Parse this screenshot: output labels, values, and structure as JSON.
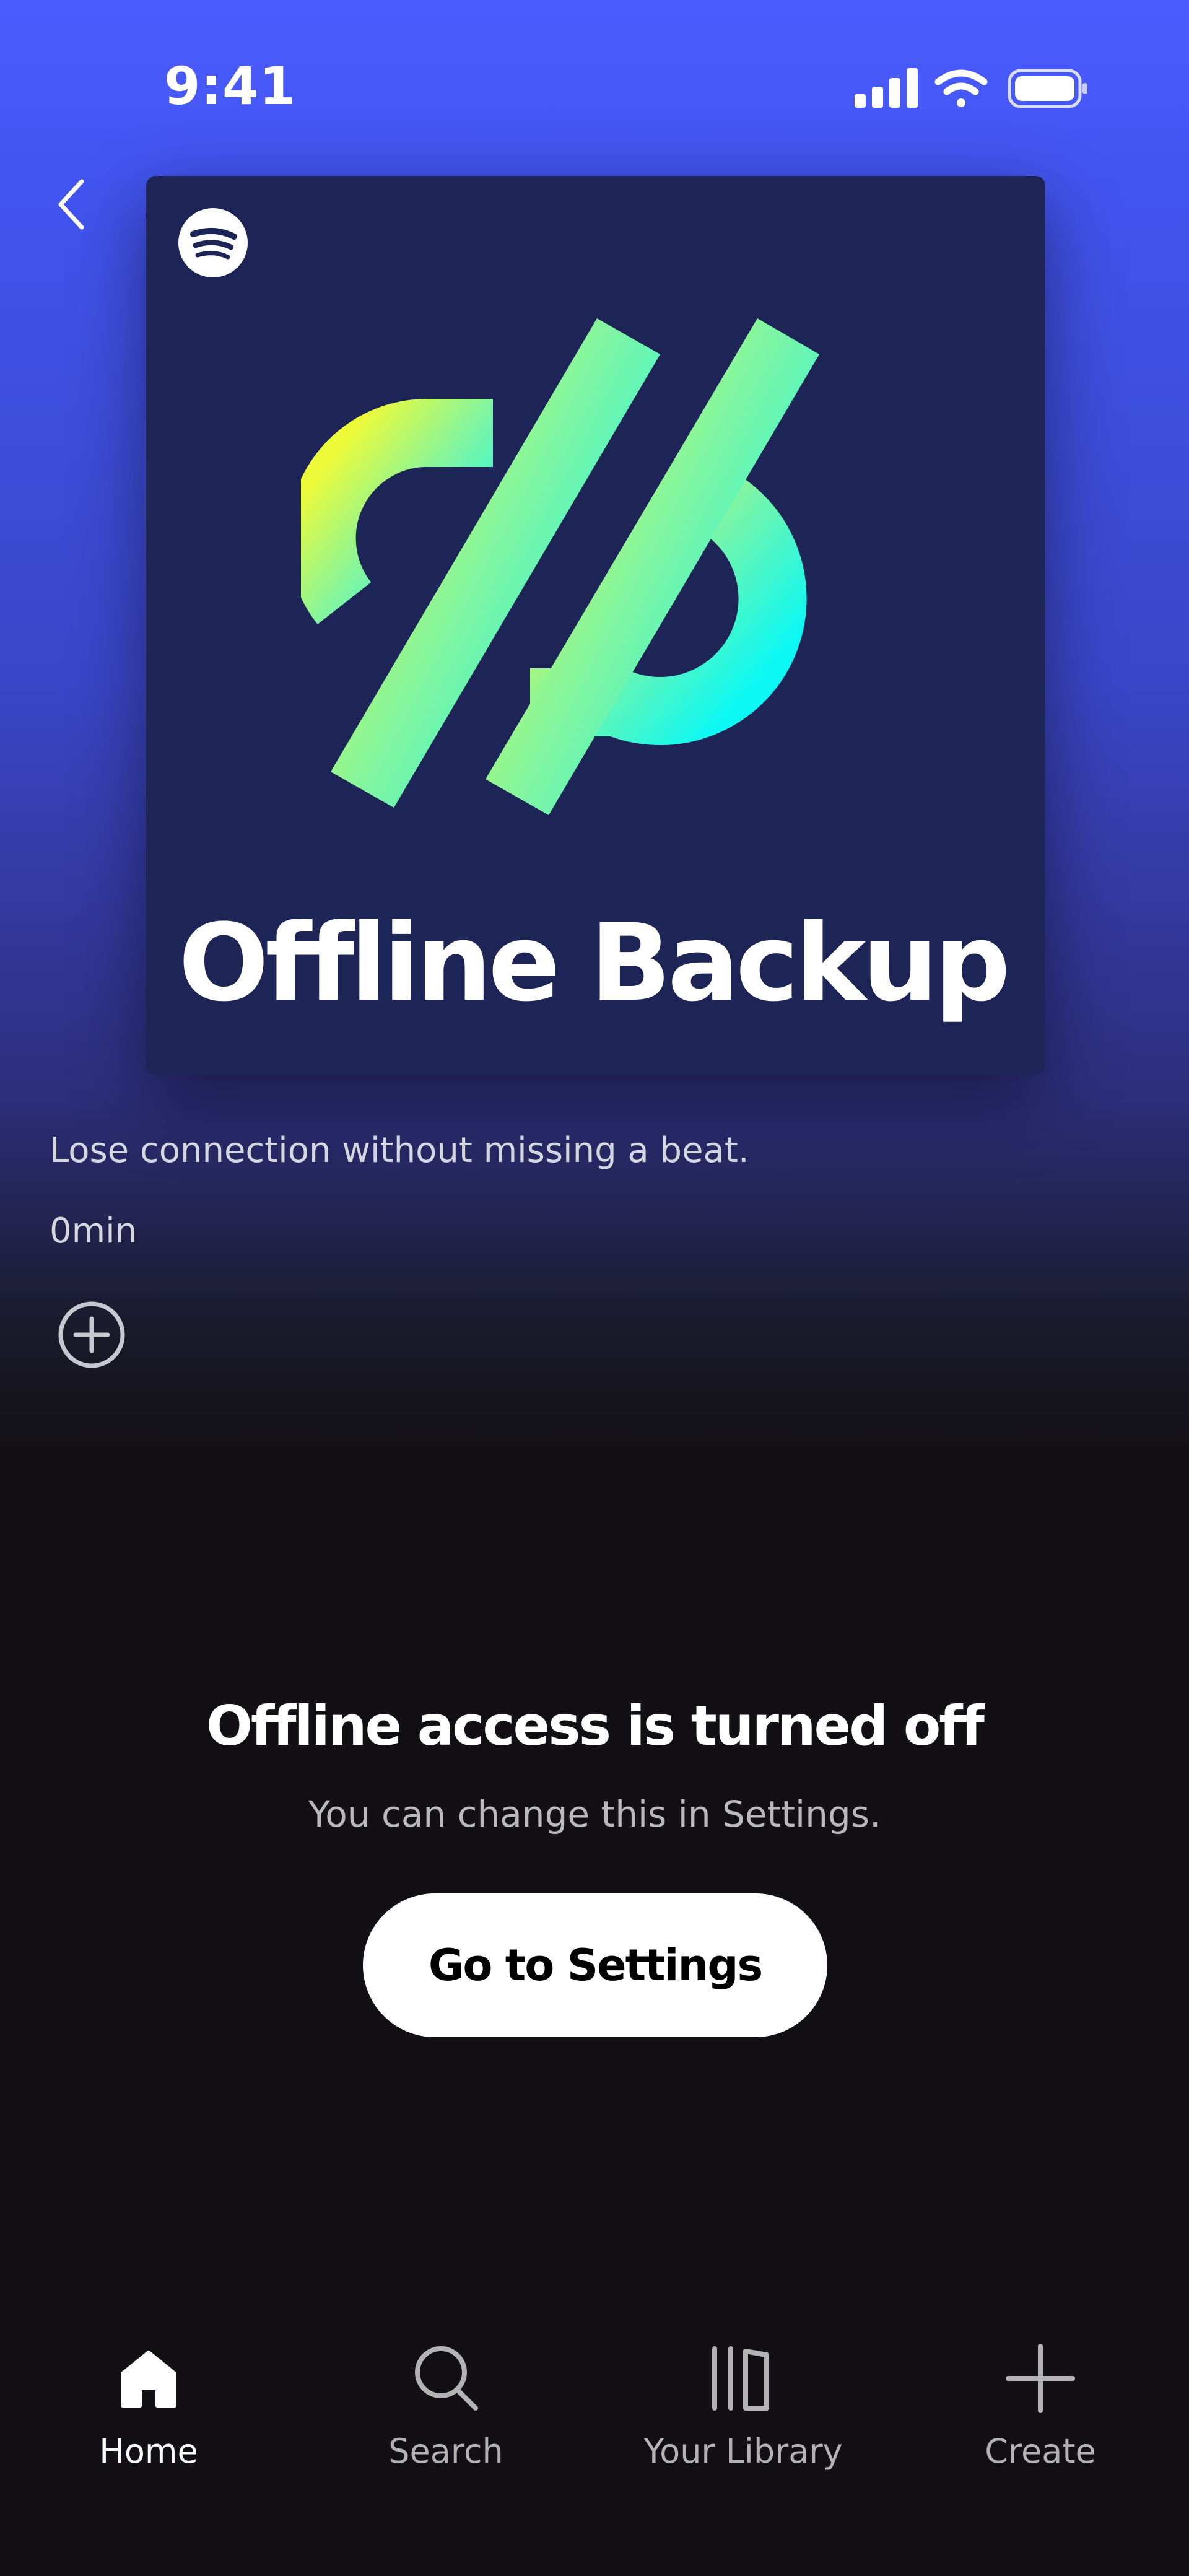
{
  "status_bar": {
    "time": "9:41"
  },
  "cover": {
    "title": "Offline Backup"
  },
  "playlist": {
    "description": "Lose connection without missing a beat.",
    "duration": "0min"
  },
  "empty_state": {
    "title": "Offline access is turned off",
    "subtitle": "You can change this in Settings.",
    "button_label": "Go to Settings"
  },
  "tabbar": {
    "tabs": [
      {
        "label": "Home",
        "icon": "home-icon",
        "active": true
      },
      {
        "label": "Search",
        "icon": "search-icon",
        "active": false
      },
      {
        "label": "Your Library",
        "icon": "library-icon",
        "active": false
      },
      {
        "label": "Create",
        "icon": "plus-icon",
        "active": false
      }
    ]
  },
  "colors": {
    "header_blue": "#4a5cfd",
    "cover_bg": "#1c2556",
    "background": "#121014",
    "gradient_start": "#ecfa3a",
    "gradient_end": "#0cf8f4"
  }
}
